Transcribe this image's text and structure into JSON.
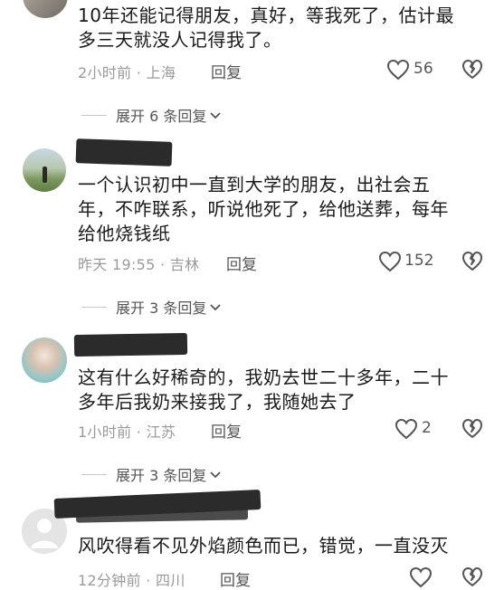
{
  "colors": {
    "text": "#1a1a1a",
    "meta": "#9a9a9a",
    "redact": "#2b2b2b",
    "bg": "#ffffff"
  },
  "comments": [
    {
      "lines": [
        "10年还能记得朋友，真好，等我死了，估计最",
        "多三天就没人记得我了。"
      ],
      "time": "2小时前 · 上海",
      "reply": "回复",
      "likes": "56",
      "expand": "展开 6 条回复"
    },
    {
      "lines": [
        "一个认识初中一直到大学的朋友，出社会五",
        "年，不咋联系，听说他死了，给他送葬，每年",
        "给他烧钱纸"
      ],
      "time": "昨天 19:55 · 吉林",
      "reply": "回复",
      "likes": "152",
      "expand": "展开 3 条回复"
    },
    {
      "lines": [
        "这有什么好稀奇的，我奶去世二十多年，二十",
        "多年后我奶来接我了，我随她去了"
      ],
      "time": "1小时前 · 江苏",
      "reply": "回复",
      "likes": "2",
      "expand": "展开 3 条回复"
    },
    {
      "lines": [
        "风吹得看不见外焰颜色而已，错觉，一直没灭"
      ],
      "time": "12分钟前 · 四川",
      "reply": "回复",
      "likes": ""
    }
  ]
}
